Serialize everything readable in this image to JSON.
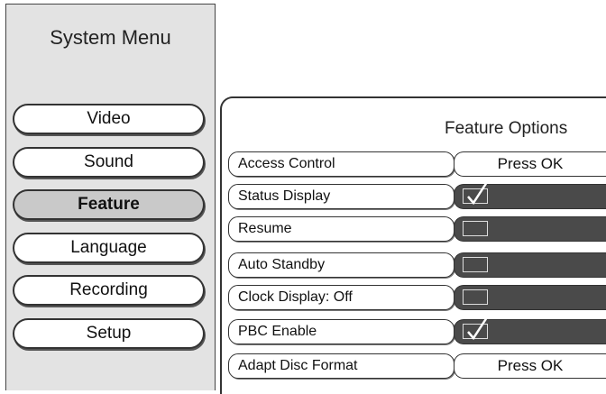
{
  "system_menu": {
    "title": "System Menu",
    "items": [
      {
        "label": "Video",
        "active": false
      },
      {
        "label": "Sound",
        "active": false
      },
      {
        "label": "Feature",
        "active": true
      },
      {
        "label": "Language",
        "active": false
      },
      {
        "label": "Recording",
        "active": false
      },
      {
        "label": "Setup",
        "active": false
      }
    ]
  },
  "feature_options": {
    "title": "Feature Options",
    "rows": [
      {
        "label": "Access Control",
        "type": "button",
        "value": "Press OK"
      },
      {
        "label": "Status Display",
        "type": "checkbox",
        "checked": true
      },
      {
        "label": "Resume",
        "type": "checkbox",
        "checked": false
      },
      {
        "label": "Auto Standby",
        "type": "checkbox",
        "checked": false
      },
      {
        "label": "Clock Display: Off",
        "type": "checkbox",
        "checked": false
      },
      {
        "label": "PBC Enable",
        "type": "checkbox",
        "checked": true
      },
      {
        "label": "Adapt Disc Format",
        "type": "button",
        "value": "Press OK"
      }
    ]
  },
  "icons": {
    "checked": "checkmark-icon",
    "unchecked": "empty-checkbox-icon"
  },
  "colors": {
    "panel_bg": "#e3e3e3",
    "active_item_bg": "#c9c9c9",
    "value_field_dark": "#4a4a4a"
  }
}
